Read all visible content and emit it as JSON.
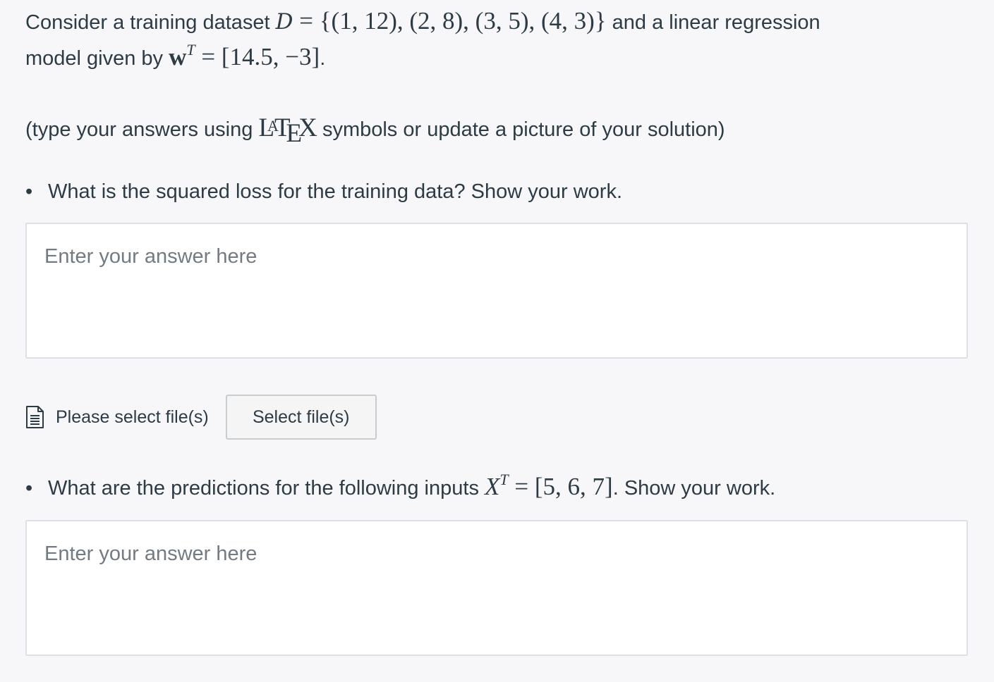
{
  "question": {
    "intro_text_1": "Consider a training dataset ",
    "dataset_symbol": "D",
    "dataset_math": " = {(1, 12), (2, 8), (3, 5), (4, 3)}",
    "intro_text_2": " and a linear regression",
    "intro_text_3": "model given by ",
    "weight_symbol": "w",
    "weight_sup": "T",
    "weight_math": " = [14.5, −3]",
    "intro_end": "."
  },
  "instruction": {
    "before": "(type your answers using ",
    "latex_L": "L",
    "latex_A": "A",
    "latex_T": "T",
    "latex_E": "E",
    "latex_X": "X",
    "after": " symbols or update a picture of your solution)"
  },
  "part1": {
    "bullet": "•",
    "prompt": "What is the squared loss for the training data?  Show your work.",
    "answer_placeholder": "Enter your answer here"
  },
  "file_upload": {
    "icon": "document-icon",
    "label": "Please select file(s)",
    "button_label": "Select file(s)"
  },
  "part2": {
    "bullet": "•",
    "prompt_before": "What are the predictions for the following inputs ",
    "input_symbol": "X",
    "input_sup": "T",
    "input_math": " = [5, 6, 7]",
    "prompt_after": ".  Show your work.",
    "answer_placeholder": "Enter your answer here"
  }
}
